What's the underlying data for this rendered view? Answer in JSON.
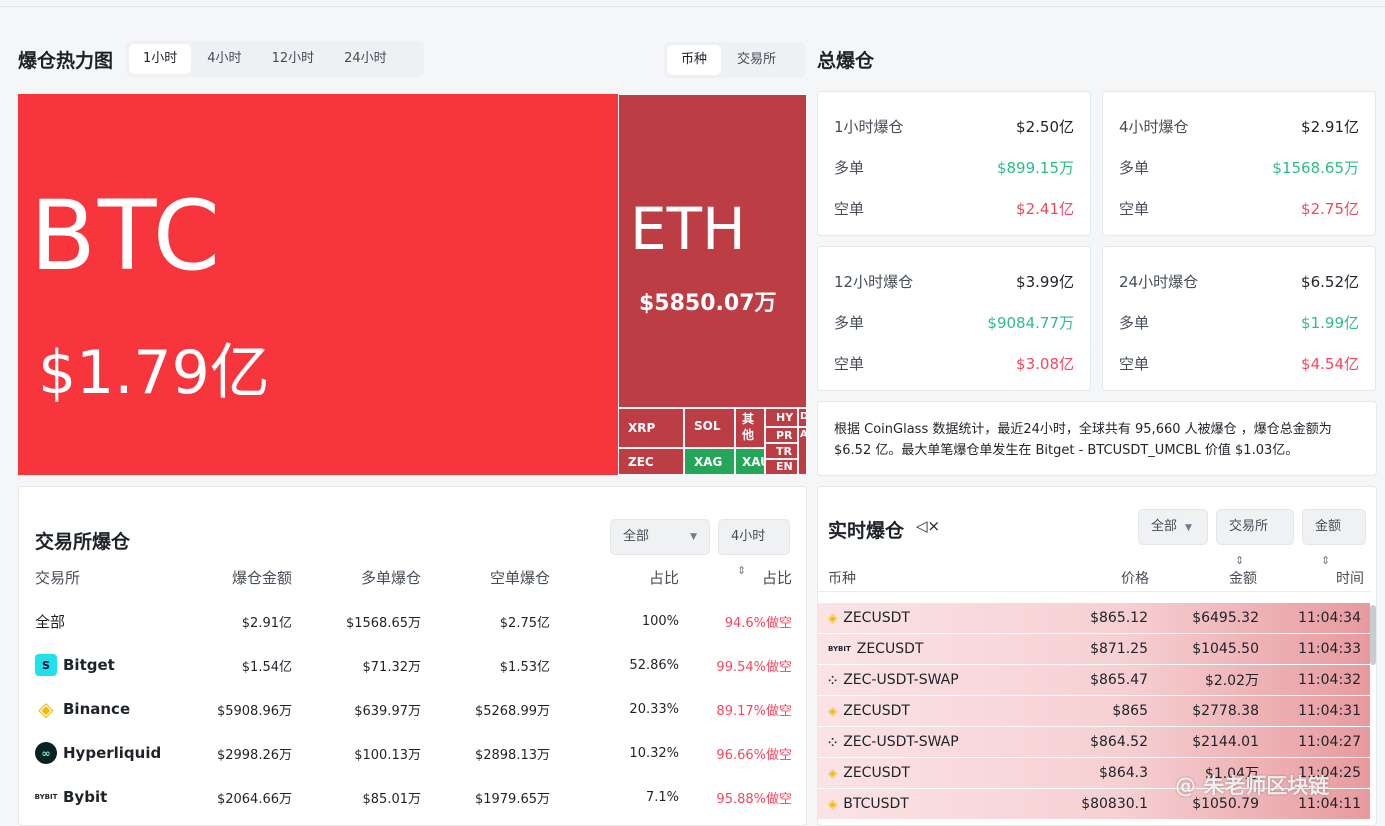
{
  "heatmap": {
    "title": "爆仓热力图",
    "time_tabs": [
      "1小时",
      "4小时",
      "12小时",
      "24小时"
    ],
    "view_tabs": [
      "币种",
      "交易所"
    ],
    "tiles": {
      "btc": {
        "symbol": "BTC",
        "value": "$1.79亿"
      },
      "eth": {
        "symbol": "ETH",
        "value": "$5850.07万"
      },
      "small": [
        "XRP",
        "SOL",
        "其他",
        "HY",
        "PR",
        "TR",
        "EN",
        "D",
        "A",
        "ZEC",
        "XAG",
        "XAU"
      ]
    }
  },
  "total": {
    "title": "总爆仓",
    "cards": [
      {
        "label": "1小时爆仓",
        "total": "$2.50亿",
        "long_label": "多单",
        "long": "$899.15万",
        "short_label": "空单",
        "short": "$2.41亿"
      },
      {
        "label": "4小时爆仓",
        "total": "$2.91亿",
        "long_label": "多单",
        "long": "$1568.65万",
        "short_label": "空单",
        "short": "$2.75亿"
      },
      {
        "label": "12小时爆仓",
        "total": "$3.99亿",
        "long_label": "多单",
        "long": "$9084.77万",
        "short_label": "空单",
        "short": "$3.08亿"
      },
      {
        "label": "24小时爆仓",
        "total": "$6.52亿",
        "long_label": "多单",
        "long": "$1.99亿",
        "short_label": "空单",
        "short": "$4.54亿"
      }
    ],
    "note": "根据 CoinGlass 数据统计，最近24小时，全球共有 95,660 人被爆仓 ，爆仓总金额为 $6.52 亿。最大单笔爆仓单发生在 Bitget - BTCUSDT_UMCBL 价值 $1.03亿。"
  },
  "exchange": {
    "title": "交易所爆仓",
    "filter_all": "全部",
    "filter_time": "4小时",
    "headers": [
      "交易所",
      "爆仓金额",
      "多单爆仓",
      "空单爆仓",
      "占比",
      "占比"
    ],
    "rows": [
      {
        "name": "全部",
        "amount": "$2.91亿",
        "long": "$1568.65万",
        "short": "$2.75亿",
        "ratio": "100%",
        "side": "94.6%做空"
      },
      {
        "name": "Bitget",
        "amount": "$1.54亿",
        "long": "$71.32万",
        "short": "$1.53亿",
        "ratio": "52.86%",
        "side": "99.54%做空"
      },
      {
        "name": "Binance",
        "amount": "$5908.96万",
        "long": "$639.97万",
        "short": "$5268.99万",
        "ratio": "20.33%",
        "side": "89.17%做空"
      },
      {
        "name": "Hyperliquid",
        "amount": "$2998.26万",
        "long": "$100.13万",
        "short": "$2898.13万",
        "ratio": "10.32%",
        "side": "96.66%做空"
      },
      {
        "name": "Bybit",
        "amount": "$2064.66万",
        "long": "$85.01万",
        "short": "$1979.65万",
        "ratio": "7.1%",
        "side": "95.88%做空"
      }
    ]
  },
  "realtime": {
    "title": "实时爆仓",
    "filters": [
      "全部",
      "交易所",
      "金额"
    ],
    "headers": [
      "币种",
      "价格",
      "金额",
      "时间"
    ],
    "rows": [
      {
        "exchange": "binance",
        "symbol": "ZECUSDT",
        "price": "$865.12",
        "amount": "$6495.32",
        "time": "11:04:34"
      },
      {
        "exchange": "bybit",
        "symbol": "ZECUSDT",
        "price": "$871.25",
        "amount": "$1045.50",
        "time": "11:04:33"
      },
      {
        "exchange": "okx",
        "symbol": "ZEC-USDT-SWAP",
        "price": "$865.47",
        "amount": "$2.02万",
        "time": "11:04:32"
      },
      {
        "exchange": "binance",
        "symbol": "ZECUSDT",
        "price": "$865",
        "amount": "$2778.38",
        "time": "11:04:31"
      },
      {
        "exchange": "okx",
        "symbol": "ZEC-USDT-SWAP",
        "price": "$864.52",
        "amount": "$2144.01",
        "time": "11:04:27"
      },
      {
        "exchange": "binance",
        "symbol": "ZECUSDT",
        "price": "$864.3",
        "amount": "$1.04万",
        "time": "11:04:25"
      },
      {
        "exchange": "binance",
        "symbol": "BTCUSDT",
        "price": "$80830.1",
        "amount": "$1050.79",
        "time": "11:04:11"
      }
    ]
  },
  "watermark": "@ 朱老师区块链"
}
